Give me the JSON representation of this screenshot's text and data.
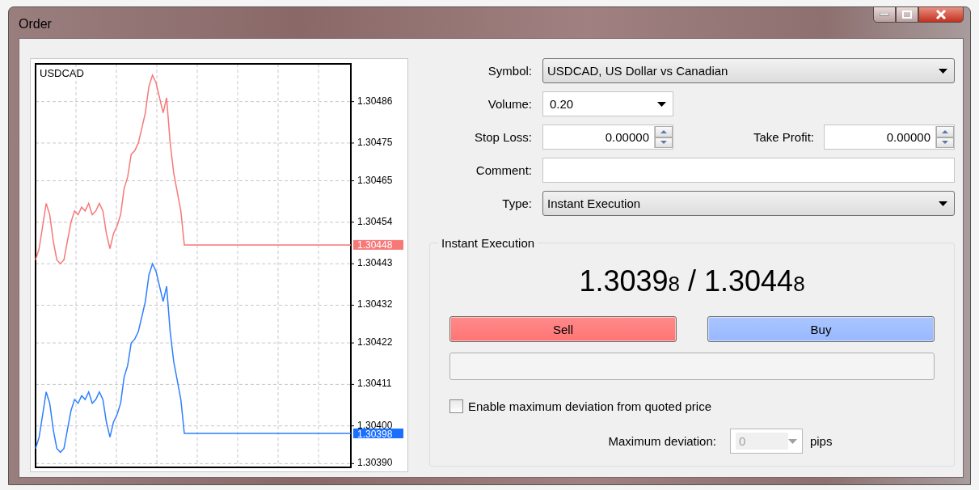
{
  "window": {
    "title": "Order"
  },
  "chart": {
    "chart_data": {
      "type": "line",
      "title": "USDCAD",
      "categories": [
        null,
        null,
        null,
        null,
        null,
        null,
        null,
        null,
        null,
        null,
        null,
        null,
        null,
        null,
        null,
        null,
        null,
        null,
        null,
        null,
        null,
        null,
        null,
        null,
        null,
        null,
        null,
        null,
        null,
        null,
        null,
        null,
        null,
        null,
        null,
        null,
        null,
        null,
        null,
        null,
        null,
        null,
        null,
        null,
        null,
        null,
        null,
        null,
        null,
        null,
        null,
        null,
        null,
        null,
        null,
        null,
        null,
        null,
        null,
        null,
        null,
        null,
        null,
        null,
        null,
        null,
        null,
        null,
        null,
        null,
        null,
        null,
        null,
        null,
        null,
        null,
        null,
        null,
        null,
        null,
        null,
        null,
        null,
        null,
        null,
        null,
        null,
        null,
        null,
        null
      ],
      "series": [
        {
          "color": "#f87878",
          "values": [
            1.30444,
            1.30447,
            1.30453,
            1.30459,
            1.30456,
            1.30449,
            1.30444,
            1.30443,
            1.30444,
            1.30449,
            1.30454,
            1.30457,
            1.30456,
            1.30458,
            1.30457,
            1.30459,
            1.30456,
            1.30457,
            1.30459,
            1.30457,
            1.30451,
            1.30447,
            1.30451,
            1.30453,
            1.30456,
            1.30463,
            1.30466,
            1.30472,
            1.30473,
            1.30475,
            1.30479,
            1.30483,
            1.3049,
            1.30493,
            1.30491,
            1.30487,
            1.30483,
            1.30487,
            1.30475,
            1.30467,
            1.30462,
            1.30457,
            1.30448,
            1.30448,
            1.30448,
            1.30448,
            1.30448,
            1.30448,
            1.30448,
            1.30448,
            1.30448,
            1.30448,
            1.30448,
            1.30448,
            1.30448,
            1.30448,
            1.30448,
            1.30448,
            1.30448,
            1.30448,
            1.30448,
            1.30448,
            1.30448,
            1.30448,
            1.30448,
            1.30448,
            1.30448,
            1.30448,
            1.30448,
            1.30448,
            1.30448,
            1.30448,
            1.30448,
            1.30448,
            1.30448,
            1.30448,
            1.30448,
            1.30448,
            1.30448,
            1.30448,
            1.30448,
            1.30448,
            1.30448,
            1.30448,
            1.30448,
            1.30448,
            1.30448,
            1.30448,
            1.30448,
            1.30448
          ]
        },
        {
          "color": "#2f7fff",
          "values": [
            1.30394,
            1.30397,
            1.30403,
            1.30409,
            1.30406,
            1.30399,
            1.30394,
            1.30393,
            1.30394,
            1.30399,
            1.30404,
            1.30407,
            1.30406,
            1.30408,
            1.30407,
            1.30409,
            1.30406,
            1.30407,
            1.30409,
            1.30407,
            1.30401,
            1.30397,
            1.30401,
            1.30403,
            1.30406,
            1.30413,
            1.30416,
            1.30422,
            1.30423,
            1.30425,
            1.30429,
            1.30433,
            1.3044,
            1.30443,
            1.30441,
            1.30437,
            1.30433,
            1.30437,
            1.30425,
            1.30417,
            1.30412,
            1.30407,
            1.30398,
            1.30398,
            1.30398,
            1.30398,
            1.30398,
            1.30398,
            1.30398,
            1.30398,
            1.30398,
            1.30398,
            1.30398,
            1.30398,
            1.30398,
            1.30398,
            1.30398,
            1.30398,
            1.30398,
            1.30398,
            1.30398,
            1.30398,
            1.30398,
            1.30398,
            1.30398,
            1.30398,
            1.30398,
            1.30398,
            1.30398,
            1.30398,
            1.30398,
            1.30398,
            1.30398,
            1.30398,
            1.30398,
            1.30398,
            1.30398,
            1.30398,
            1.30398,
            1.30398,
            1.30398,
            1.30398,
            1.30398,
            1.30398,
            1.30398,
            1.30398,
            1.30398,
            1.30398,
            1.30398,
            1.30398
          ]
        }
      ],
      "ylim": [
        1.30389,
        1.30496
      ],
      "grid": true,
      "yticks": [
        {
          "value": 1.30486,
          "label": "1.30486"
        },
        {
          "value": 1.30475,
          "label": "1.30475"
        },
        {
          "value": 1.30465,
          "label": "1.30465"
        },
        {
          "value": 1.30454,
          "label": "1.30454"
        },
        {
          "value": 1.30443,
          "label": "1.30443"
        },
        {
          "value": 1.30432,
          "label": "1.30432"
        },
        {
          "value": 1.30422,
          "label": "1.30422"
        },
        {
          "value": 1.30411,
          "label": "1.30411"
        },
        {
          "value": 1.304,
          "label": "1.30400"
        },
        {
          "value": 1.3039,
          "label": "1.30390"
        }
      ]
    },
    "price_tags": [
      {
        "text": "1.30448",
        "color": "#f87878"
      },
      {
        "text": "1.30398",
        "color": "#1a6fff"
      }
    ]
  },
  "form": {
    "symbol": {
      "label": "Symbol:",
      "value": "USDCAD, US Dollar vs Canadian"
    },
    "volume": {
      "label": "Volume:",
      "value": "0.20"
    },
    "stop_loss": {
      "label": "Stop Loss:",
      "value": "0.00000"
    },
    "take_profit": {
      "label": "Take Profit:",
      "value": "0.00000"
    },
    "comment": {
      "label": "Comment:"
    },
    "type": {
      "label": "Type:",
      "value": "Instant Execution"
    }
  },
  "execution": {
    "title": "Instant Execution",
    "bid": {
      "main": "1.3039",
      "small": "8"
    },
    "separator": "/",
    "ask": {
      "main": "1.3044",
      "small": "8"
    },
    "buttons": [
      {
        "label": "Sell",
        "kind": "sell"
      },
      {
        "label": "Buy",
        "kind": "buy"
      }
    ],
    "enable_deviation": {
      "label": "Enable maximum deviation from quoted price",
      "checked": false
    },
    "deviation": {
      "label": "Maximum deviation:",
      "value": "0",
      "disabled": true,
      "unit": "pips"
    }
  }
}
